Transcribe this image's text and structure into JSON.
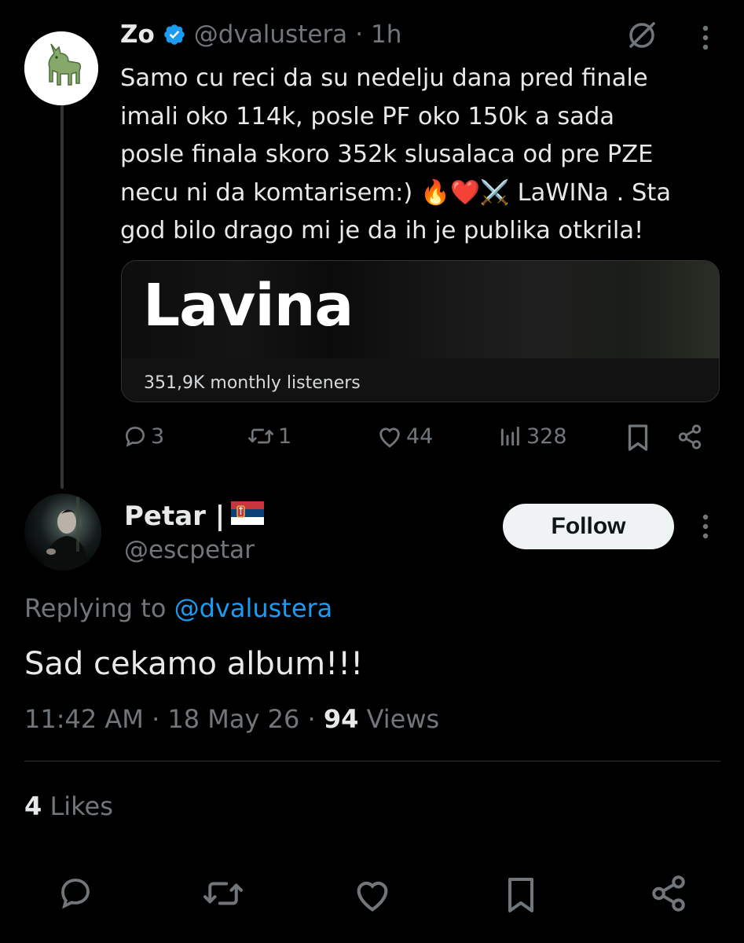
{
  "parent_tweet": {
    "author_name": "Zo",
    "verified": true,
    "handle": "@dvalustera",
    "separator": "·",
    "time": "1h",
    "text_lines": [
      "Samo cu reci da su nedelju dana pred finale",
      "imali oko 114k, posle PF oko 150k a sada",
      "posle finala skoro 352k slusalaca od pre PZE",
      "necu ni da komtarisem:) 🔥❤️⚔️ LaWINa . Sta",
      "god bilo drago mi je da ih je publika otkrila!"
    ],
    "card": {
      "title": "Lavina",
      "listeners": "351,9K monthly listeners"
    },
    "stats": {
      "replies": "3",
      "reposts": "1",
      "likes": "44",
      "views": "328"
    }
  },
  "reply_tweet": {
    "author_name": "Petar |",
    "flag": "🇷🇸",
    "handle": "@escpetar",
    "follow_label": "Follow",
    "replying_prefix": "Replying to",
    "replying_to": "@dvalustera",
    "text": "Sad cekamo album!!!",
    "time": "11:42 AM",
    "date": "18 May 26",
    "separator": "·",
    "views_count": "94",
    "views_label": "Views",
    "likes_count": "4",
    "likes_label": "Likes"
  },
  "icons": {
    "verified": "verified-badge-icon",
    "grok": "grok-icon",
    "more": "more-dots-icon",
    "reply": "reply-bubble-icon",
    "repost": "repost-icon",
    "like": "heart-icon",
    "views": "views-bar-icon",
    "bookmark": "bookmark-icon",
    "share": "share-icon"
  },
  "colors": {
    "background": "#000000",
    "text": "#e7e9ea",
    "muted": "#71767b",
    "link": "#1d9bf0",
    "verified": "#1d9bf0",
    "follow_bg": "#eff3f4"
  }
}
